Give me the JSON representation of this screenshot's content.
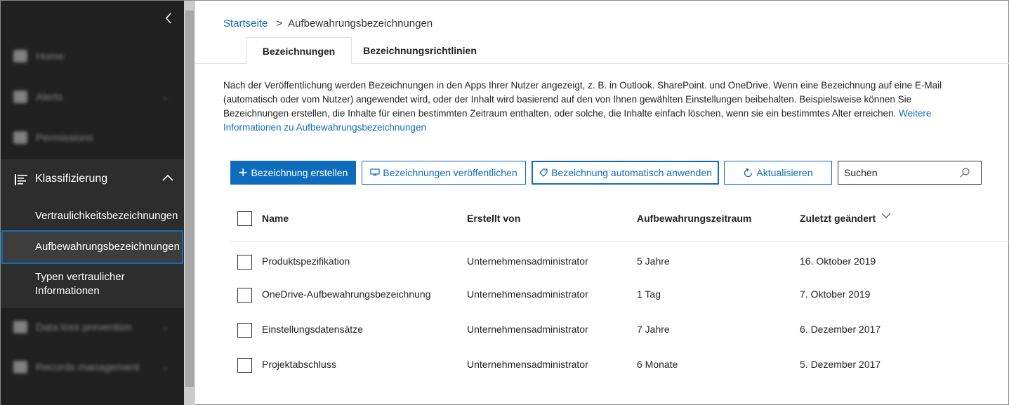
{
  "sidebar": {
    "blurred_items": [
      "Home",
      "Alerts",
      "Permissions",
      "Data loss prevention",
      "Records management"
    ],
    "group": {
      "label": "Klassifizierung",
      "items": [
        {
          "label": "Vertraulichkeitsbezeichnungen"
        },
        {
          "label": "Aufbewahrungsbezeichnungen"
        },
        {
          "label": "Typen vertraulicher Informationen"
        }
      ]
    }
  },
  "breadcrumb": {
    "home": "Startseite",
    "separator": ">",
    "current": "Aufbewahrungsbezeichnungen"
  },
  "tabs": [
    {
      "label": "Bezeichnungen"
    },
    {
      "label": "Bezeichnungsrichtlinien"
    }
  ],
  "description": {
    "text": "Nach der Veröffentlichung werden Bezeichnungen in den Apps Ihrer Nutzer angezeigt, z. B. in Outlook. SharePoint. und OneDrive. Wenn eine Bezeichnung auf eine E-Mail (automatisch oder vom Nutzer) angewendet wird, oder der Inhalt wird basierend auf den von Ihnen gewählten Einstellungen beibehalten. Beispielsweise können Sie Bezeichnungen erstellen, die Inhalte für einen bestimmten Zeitraum enthalten, oder solche, die Inhalte einfach löschen, wenn sie ein bestimmtes Alter erreichen.",
    "link": "Weitere Informationen zu Aufbewahrungsbezeichnungen"
  },
  "toolbar": {
    "create": "Bezeichnung erstellen",
    "publish": "Bezeichnungen veröffentlichen",
    "auto_apply": "Bezeichnung automatisch anwenden",
    "refresh": "Aktualisieren",
    "search_placeholder": "Suchen"
  },
  "table": {
    "columns": [
      "Name",
      "Erstellt von",
      "Aufbewahrungszeitraum",
      "Zuletzt geändert"
    ],
    "rows": [
      {
        "name": "Produktspezifikation",
        "created_by": "Unternehmensadministrator",
        "period": "5 Jahre",
        "modified": "16. Oktober 2019"
      },
      {
        "name": "OneDrive-Aufbewahrungsbezeichnung",
        "created_by": "Unternehmensadministrator",
        "period": "1 Tag",
        "modified": "7. Oktober 2019"
      },
      {
        "name": "Einstellungsdatensätze",
        "created_by": "Unternehmensadministrator",
        "period": "7 Jahre",
        "modified": "6. Dezember 2017"
      },
      {
        "name": "Projektabschluss",
        "created_by": "Unternehmensadministrator",
        "period": "6 Monate",
        "modified": "5. Dezember 2017"
      }
    ]
  },
  "colors": {
    "accent": "#0f6cbd",
    "sidebar_bg": "#202020",
    "sidebar_group_bg": "#2d2d2d"
  }
}
